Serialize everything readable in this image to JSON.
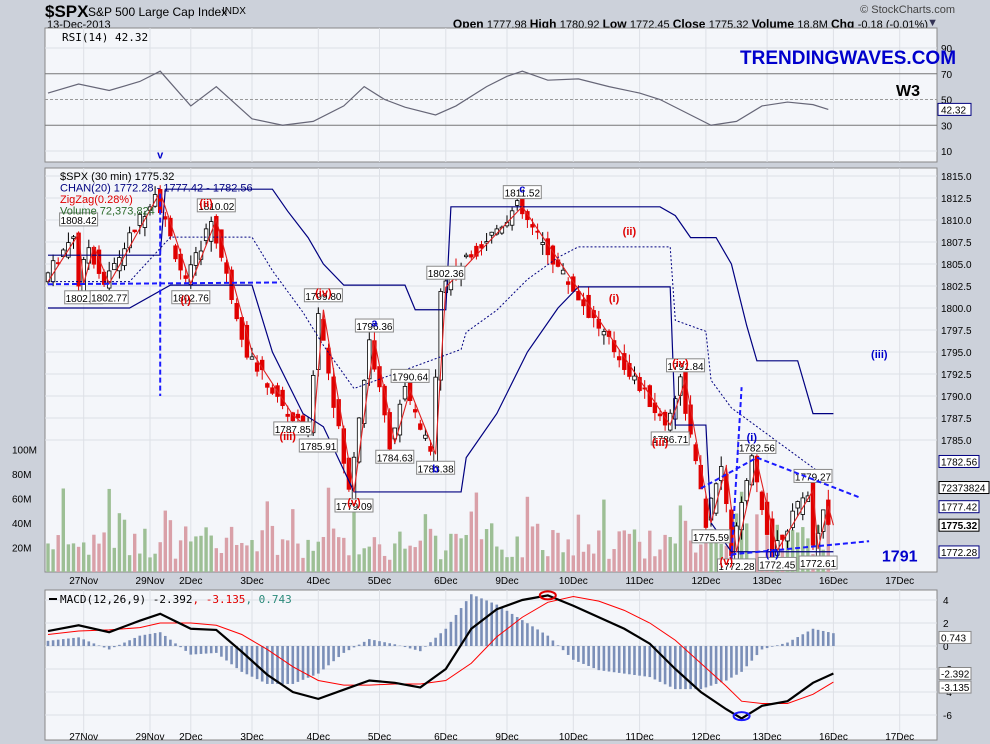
{
  "header": {
    "symbol": "$SPX",
    "name": "S&P 500 Large Cap Index",
    "exchange": "INDX",
    "date": "13-Dec-2013",
    "copyright": "© StockCharts.com",
    "ohlc": [
      {
        "k": "Open",
        "v": "1777.98"
      },
      {
        "k": "High",
        "v": "1780.92"
      },
      {
        "k": "Low",
        "v": "1772.45"
      },
      {
        "k": "Close",
        "v": "1775.32"
      },
      {
        "k": "Volume",
        "v": "18.8M"
      },
      {
        "k": "Chg",
        "v": "-0.18 (-0.01%)"
      }
    ]
  },
  "watermark": "TRENDINGWAVES.COM",
  "colors": {
    "up": "#000000",
    "down": "#e00000",
    "channel": "#000080",
    "zigzag": "#e02020",
    "vol_up": "#9dbf95",
    "vol_down": "#d9a0a8",
    "macd": "#000000",
    "signal": "#ff0000",
    "hist": "#7b8fb8",
    "wave_blue": "#0000cc"
  },
  "chart_data": [
    {
      "type": "line",
      "title": "RSI(14) 42.32",
      "legend": "RSI(14) 42.32",
      "ylim": [
        0,
        100
      ],
      "yticks": [
        "90",
        "70",
        "50",
        "30",
        "10"
      ],
      "ytick_values": [
        90,
        70,
        50,
        30,
        10
      ],
      "last_label": "42.32",
      "annotation": "W3",
      "x": [
        0,
        6,
        12,
        18,
        22,
        28,
        33,
        40,
        46,
        52,
        58,
        62,
        66,
        70,
        76,
        80,
        86,
        90,
        93,
        98,
        104,
        110,
        116,
        120,
        125,
        130,
        135,
        140,
        145,
        150,
        153
      ],
      "values": [
        55,
        62,
        57,
        64,
        72,
        45,
        60,
        35,
        30,
        33,
        45,
        60,
        50,
        44,
        38,
        45,
        60,
        68,
        72,
        65,
        66,
        60,
        55,
        50,
        40,
        30,
        33,
        45,
        48,
        46,
        42.32
      ]
    },
    {
      "type": "candlestick",
      "title": "$SPX (30 min) 1775.32",
      "legend": [
        "$SPX (30 min) 1775.32",
        "CHAN(20) 1772.28 - 1777.42 - 1782.56",
        "ZigZag(0.28%)",
        "Volume 72,373,824"
      ],
      "ylim": [
        1771,
        1816
      ],
      "yticks": [
        "1815.0",
        "1812.5",
        "1810.0",
        "1807.5",
        "1805.0",
        "1802.5",
        "1800.0",
        "1797.5",
        "1795.0",
        "1792.5",
        "1790.0",
        "1787.5",
        "1785.0"
      ],
      "ytick_values": [
        1815,
        1812.5,
        1810,
        1807.5,
        1805,
        1802.5,
        1800,
        1797.5,
        1795,
        1792.5,
        1790,
        1787.5,
        1785
      ],
      "right_tags": [
        {
          "v": 1782.56,
          "label": "1782.56",
          "kind": "chan"
        },
        {
          "v": 1779.6,
          "label": "72373824",
          "kind": "vol"
        },
        {
          "v": 1777.42,
          "label": "1777.42",
          "kind": "chan"
        },
        {
          "v": 1775.32,
          "label": "1775.32",
          "kind": "close"
        },
        {
          "v": 1772.28,
          "label": "1772.28",
          "kind": "chan"
        }
      ],
      "xticks": [
        {
          "i": 7,
          "label": "27Nov"
        },
        {
          "i": 20,
          "label": "29Nov"
        },
        {
          "i": 28,
          "label": "2Dec"
        },
        {
          "i": 40,
          "label": "3Dec"
        },
        {
          "i": 53,
          "label": "4Dec"
        },
        {
          "i": 65,
          "label": "5Dec"
        },
        {
          "i": 78,
          "label": "6Dec"
        },
        {
          "i": 90,
          "label": "9Dec"
        },
        {
          "i": 103,
          "label": "10Dec"
        },
        {
          "i": 116,
          "label": "11Dec"
        },
        {
          "i": 129,
          "label": "12Dec"
        },
        {
          "i": 141,
          "label": "13Dec"
        },
        {
          "i": 154,
          "label": "16Dec"
        },
        {
          "i": 167,
          "label": "17Dec"
        }
      ],
      "zigzag": [
        [
          0,
          1803
        ],
        [
          6,
          1808.42
        ],
        [
          7,
          1802.75
        ],
        [
          9,
          1807
        ],
        [
          12,
          1802.77
        ],
        [
          22,
          1813.2
        ],
        [
          28,
          1802.76
        ],
        [
          33,
          1810.02
        ],
        [
          40,
          1795
        ],
        [
          48,
          1787.85
        ],
        [
          52,
          1785.91
        ],
        [
          54,
          1799.8
        ],
        [
          60,
          1779.09
        ],
        [
          64,
          1796.36
        ],
        [
          68,
          1784.63
        ],
        [
          71,
          1790.64
        ],
        [
          76,
          1783.38
        ],
        [
          78,
          1802.36
        ],
        [
          93,
          1811.52
        ],
        [
          122,
          1786.71
        ],
        [
          125,
          1791.84
        ],
        [
          130,
          1775.59
        ],
        [
          133,
          1782
        ],
        [
          135,
          1772.28
        ],
        [
          139,
          1782.56
        ],
        [
          143,
          1772.45
        ],
        [
          150,
          1779.27
        ],
        [
          151,
          1772.61
        ],
        [
          153,
          1777.5
        ],
        [
          154,
          1775.32
        ]
      ],
      "pivot_labels": [
        [
          6,
          1808.42,
          "1808.42",
          1
        ],
        [
          7,
          1802.75,
          "1802.75",
          0
        ],
        [
          12,
          1802.77,
          "1802.77",
          0
        ],
        [
          28,
          1802.76,
          "1802.76",
          0
        ],
        [
          33,
          1810.02,
          "1810.02",
          1
        ],
        [
          48,
          1787.85,
          "1787.85",
          0
        ],
        [
          53,
          1785.91,
          "1785.91",
          0
        ],
        [
          54,
          1799.8,
          "1799.80",
          1
        ],
        [
          60,
          1779.09,
          "1779.09",
          0
        ],
        [
          64,
          1796.36,
          "1796.36",
          1
        ],
        [
          68,
          1784.63,
          "1784.63",
          0
        ],
        [
          71,
          1790.64,
          "1790.64",
          1
        ],
        [
          76,
          1783.38,
          "1783.38",
          0
        ],
        [
          78,
          1802.36,
          "1802.36",
          1
        ],
        [
          93,
          1811.52,
          "1811.52",
          1
        ],
        [
          122,
          1786.71,
          "1786.71",
          0
        ],
        [
          125,
          1791.84,
          "1791.84",
          1
        ],
        [
          130,
          1775.59,
          "1775.59",
          0
        ],
        [
          135,
          1772.28,
          "1772.28",
          0
        ],
        [
          139,
          1782.56,
          "1782.56",
          1
        ],
        [
          143,
          1772.45,
          "1772.45",
          0
        ],
        [
          150,
          1779.27,
          "1779.27",
          1
        ],
        [
          151,
          1772.61,
          "1772.61",
          0
        ]
      ],
      "chan_upper": [
        [
          0,
          1806
        ],
        [
          22,
          1806
        ],
        [
          23,
          1813.5
        ],
        [
          44,
          1813.5
        ],
        [
          47,
          1811
        ],
        [
          51,
          1808
        ],
        [
          54,
          1805
        ],
        [
          58,
          1802.6
        ],
        [
          70,
          1802.6
        ],
        [
          72,
          1799.8
        ],
        [
          78,
          1799.8
        ],
        [
          79,
          1811.5
        ],
        [
          120,
          1811.5
        ],
        [
          123,
          1810.5
        ],
        [
          126,
          1808
        ],
        [
          131,
          1808
        ],
        [
          134,
          1805
        ],
        [
          137,
          1798
        ],
        [
          139,
          1794
        ],
        [
          147,
          1794
        ],
        [
          150,
          1788
        ],
        [
          154,
          1788
        ]
      ],
      "chan_lower": [
        [
          0,
          1800
        ],
        [
          16,
          1800
        ],
        [
          24,
          1802.6
        ],
        [
          40,
          1802.6
        ],
        [
          44,
          1795
        ],
        [
          50,
          1788
        ],
        [
          54,
          1786.5
        ],
        [
          60,
          1779.1
        ],
        [
          81,
          1779.1
        ],
        [
          82,
          1783
        ],
        [
          88,
          1788
        ],
        [
          94,
          1795
        ],
        [
          100,
          1800
        ],
        [
          104,
          1802.4
        ],
        [
          122,
          1802.4
        ],
        [
          123,
          1786.7
        ],
        [
          129,
          1786.7
        ],
        [
          130,
          1775.6
        ],
        [
          134,
          1772.3
        ],
        [
          154,
          1772.3
        ]
      ],
      "wave_labels": [
        {
          "i": 22,
          "v": 1817,
          "t": "v",
          "c": "blue"
        },
        {
          "i": 31,
          "v": 1811.5,
          "t": "(ii)",
          "c": "red"
        },
        {
          "i": 27,
          "v": 1800.5,
          "t": "(i)",
          "c": "red"
        },
        {
          "i": 54,
          "v": 1801.3,
          "t": "(iv)",
          "c": "red"
        },
        {
          "i": 47,
          "v": 1785,
          "t": "(iii)",
          "c": "red"
        },
        {
          "i": 60,
          "v": 1777.5,
          "t": "(v)",
          "c": "red"
        },
        {
          "i": 64,
          "v": 1797.9,
          "t": "a",
          "c": "blue"
        },
        {
          "i": 76,
          "v": 1781.3,
          "t": "b",
          "c": "blue"
        },
        {
          "i": 93,
          "v": 1813.1,
          "t": "c",
          "c": "blue"
        },
        {
          "i": 114,
          "v": 1808.3,
          "t": "(ii)",
          "c": "red"
        },
        {
          "i": 111,
          "v": 1800.7,
          "t": "(i)",
          "c": "red"
        },
        {
          "i": 124,
          "v": 1793.3,
          "t": "(iv)",
          "c": "red"
        },
        {
          "i": 120,
          "v": 1784.3,
          "t": "(iii)",
          "c": "red"
        },
        {
          "i": 133,
          "v": 1770.8,
          "t": "(v)",
          "c": "red"
        },
        {
          "i": 138,
          "v": 1784.9,
          "t": "(i)",
          "c": "blue"
        },
        {
          "i": 142,
          "v": 1771.7,
          "t": "(ii)",
          "c": "blue"
        },
        {
          "i": 163,
          "v": 1794.3,
          "t": "(iii)",
          "c": "blue"
        },
        {
          "i": 167,
          "v": 1771.2,
          "t": "1791",
          "c": "blue",
          "big": 1
        }
      ],
      "volume_ticks": [
        "100M",
        "80M",
        "60M",
        "40M",
        "20M"
      ],
      "volume_tick_values": [
        100,
        80,
        60,
        40,
        20
      ]
    },
    {
      "type": "line",
      "title": "MACD(12,26,9)",
      "legend": {
        "name": "MACD(12,26,9)",
        "macd": "-2.392",
        "signal": ", -3.135",
        "hist": ", 0.743"
      },
      "ylim": [
        -7,
        5
      ],
      "yticks": [
        "4",
        "2",
        "0",
        "-2",
        "-4",
        "-6"
      ],
      "ytick_values": [
        4,
        2,
        0,
        -2,
        -4,
        -6
      ],
      "right_tags": [
        {
          "v": 0.743,
          "label": "0.743"
        },
        {
          "v": -2.392,
          "label": "-2.392"
        },
        {
          "v": -3.135,
          "label": "-3.135"
        }
      ],
      "x": [
        0,
        6,
        12,
        18,
        22,
        28,
        33,
        38,
        43,
        48,
        53,
        58,
        63,
        68,
        73,
        78,
        83,
        88,
        93,
        98,
        103,
        108,
        113,
        118,
        123,
        128,
        133,
        136,
        140,
        145,
        150,
        154
      ],
      "macd": [
        1.3,
        1.8,
        1.2,
        2.2,
        2.8,
        1.5,
        1.4,
        -0.5,
        -2.5,
        -4.0,
        -4.6,
        -3.8,
        -3.0,
        -3.2,
        -3.6,
        -2.0,
        1.5,
        3.2,
        4.0,
        4.4,
        3.5,
        2.5,
        1.5,
        0.2,
        -2.0,
        -4.0,
        -5.5,
        -6.3,
        -5.2,
        -4.8,
        -3.2,
        -2.392
      ],
      "signal": [
        1.0,
        1.3,
        1.4,
        1.6,
        2.0,
        2.0,
        1.8,
        1.0,
        -0.3,
        -1.8,
        -3.0,
        -3.4,
        -3.4,
        -3.3,
        -3.3,
        -3.0,
        -1.5,
        0.8,
        2.5,
        3.8,
        4.3,
        3.9,
        3.1,
        2.0,
        0.5,
        -1.5,
        -3.5,
        -4.8,
        -5.0,
        -5.0,
        -4.2,
        -3.135
      ],
      "circles": [
        {
          "i": 98,
          "v": 4.4
        },
        {
          "i": 136,
          "v": -6.1
        }
      ]
    }
  ]
}
